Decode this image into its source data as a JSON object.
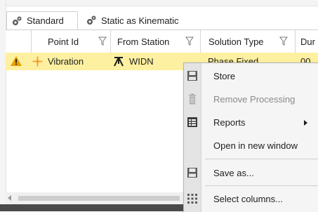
{
  "tabs": [
    {
      "label": "Standard",
      "icon": "gear-icon",
      "active": true
    },
    {
      "label": "Static as Kinematic",
      "icon": "gear-icon",
      "active": false
    }
  ],
  "grid": {
    "columns": [
      {
        "label": "Point Id",
        "filter_icon": "filter-icon"
      },
      {
        "label": "From Station",
        "filter_icon": "filter-icon"
      },
      {
        "label": "Solution Type",
        "filter_icon": "filter-icon"
      },
      {
        "label": "Dur",
        "filter_icon": ""
      }
    ],
    "rows": [
      {
        "status_icon": "warning-icon",
        "point_icon": "crosshair-point-icon",
        "point_id": "Vibration",
        "station_icon": "tripod-station-icon",
        "from_station": "WIDN",
        "solution_type": "Phase Fixed",
        "duration": "00"
      }
    ],
    "selected_row_color": "#fdf0a0"
  },
  "context_menu": {
    "items": [
      {
        "label": "Store",
        "icon": "save-disk-icon",
        "enabled": true,
        "submenu": false
      },
      {
        "label": "Remove Processing",
        "icon": "trash-icon",
        "enabled": false,
        "submenu": false
      },
      {
        "label": "Reports",
        "icon": "report-table-icon",
        "enabled": true,
        "submenu": true
      },
      {
        "label": "Open in new window",
        "icon": "",
        "enabled": true,
        "submenu": false
      },
      {
        "label": "Save as...",
        "icon": "save-disk-icon",
        "enabled": true,
        "submenu": false
      },
      {
        "label": "Select columns...",
        "icon": "columns-grid-icon",
        "enabled": true,
        "submenu": false
      }
    ]
  },
  "colors": {
    "warning": "#e8a100",
    "point_orange": "#f0a030",
    "accent_gear": "#5a5a5a"
  }
}
